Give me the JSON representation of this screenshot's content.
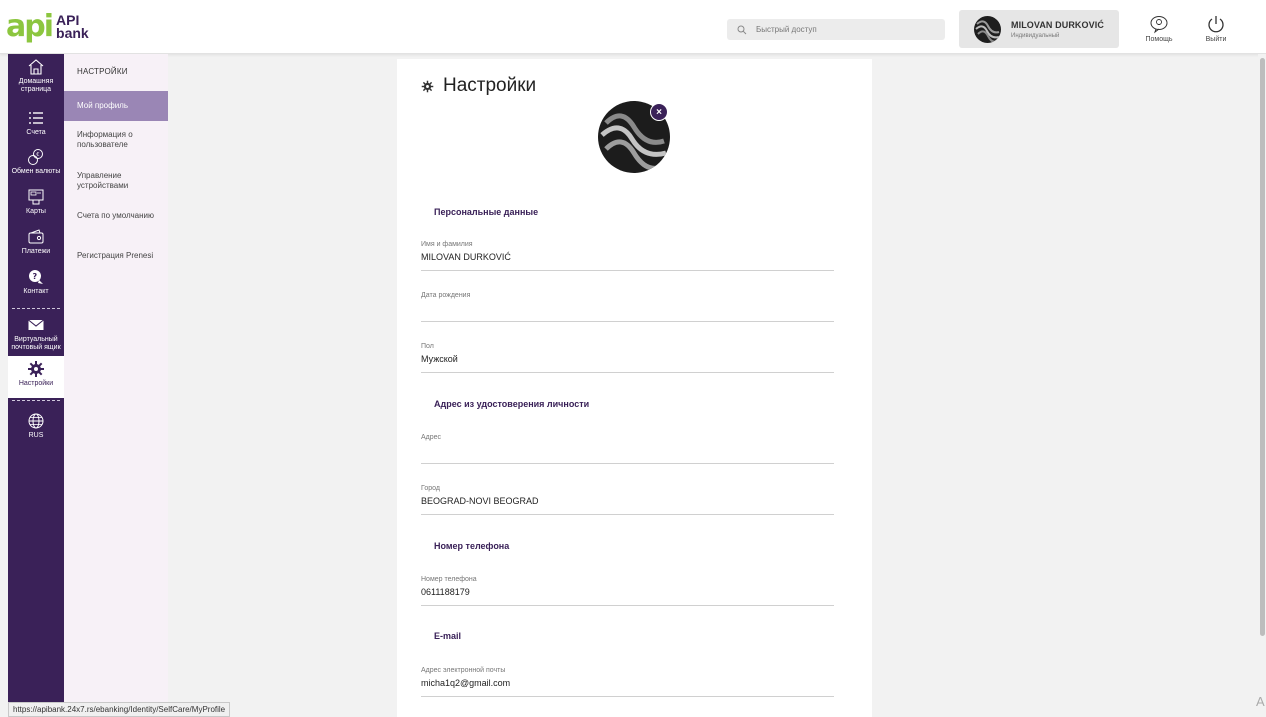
{
  "header": {
    "logo_mark": "api",
    "logo_line1": "API",
    "logo_line2": "bank",
    "search_placeholder": "Быстрый доступ",
    "user_name": "MILOVAN DURKOVIĆ",
    "user_type": "Индивидуальный",
    "help_label": "Помощь",
    "logout_label": "Выйти"
  },
  "nav": {
    "items": [
      {
        "label": "Домашняя страница",
        "icon": "home-icon"
      },
      {
        "label": "Счета",
        "icon": "list-icon"
      },
      {
        "label": "Обмен валюты",
        "icon": "currency-exchange-icon"
      },
      {
        "label": "Карты",
        "icon": "cards-icon"
      },
      {
        "label": "Платежи",
        "icon": "wallet-icon"
      },
      {
        "label": "Контакт",
        "icon": "chat-icon"
      },
      {
        "label": "Виртуальный почтовый ящик",
        "icon": "mail-icon"
      },
      {
        "label": "Настройки",
        "icon": "gear-icon"
      },
      {
        "label": "RUS",
        "icon": "globe-icon"
      }
    ]
  },
  "submenu": {
    "title": "НАСТРОЙКИ",
    "items": [
      {
        "label": "Мой профиль"
      },
      {
        "label": "Информация о пользователе"
      },
      {
        "label": "Управление устройствами"
      },
      {
        "label": "Счета по умолчанию"
      },
      {
        "label": "Регистрация Prenesi"
      }
    ]
  },
  "main": {
    "title": "Настройки",
    "close_glyph": "×",
    "sections": {
      "personal": "Персональные данные",
      "address": "Адрес из удостоверения личности",
      "phone": "Номер телефона",
      "email": "E-mail"
    },
    "fields": {
      "full_name": {
        "label": "Имя и фамилия",
        "value": "MILOVAN DURKOVIĆ"
      },
      "birth_date": {
        "label": "Дата рождения",
        "value": ""
      },
      "gender": {
        "label": "Пол",
        "value": "Мужской"
      },
      "address": {
        "label": "Адрес",
        "value": ""
      },
      "city": {
        "label": "Город",
        "value": "BEOGRAD-NOVI BEOGRAD"
      },
      "phone": {
        "label": "Номер телефона",
        "value": "0611188179"
      },
      "email": {
        "label": "Адрес электронной почты",
        "value": "micha1q2@gmail.com"
      }
    }
  },
  "status_url": "https://apibank.24x7.rs/ebanking/Identity/SelfCare/MyProfile",
  "corner_char": "A",
  "colors": {
    "brand_purple": "#3a2158",
    "brand_green": "#8cc63f",
    "submenu_active": "#9a86b5"
  }
}
